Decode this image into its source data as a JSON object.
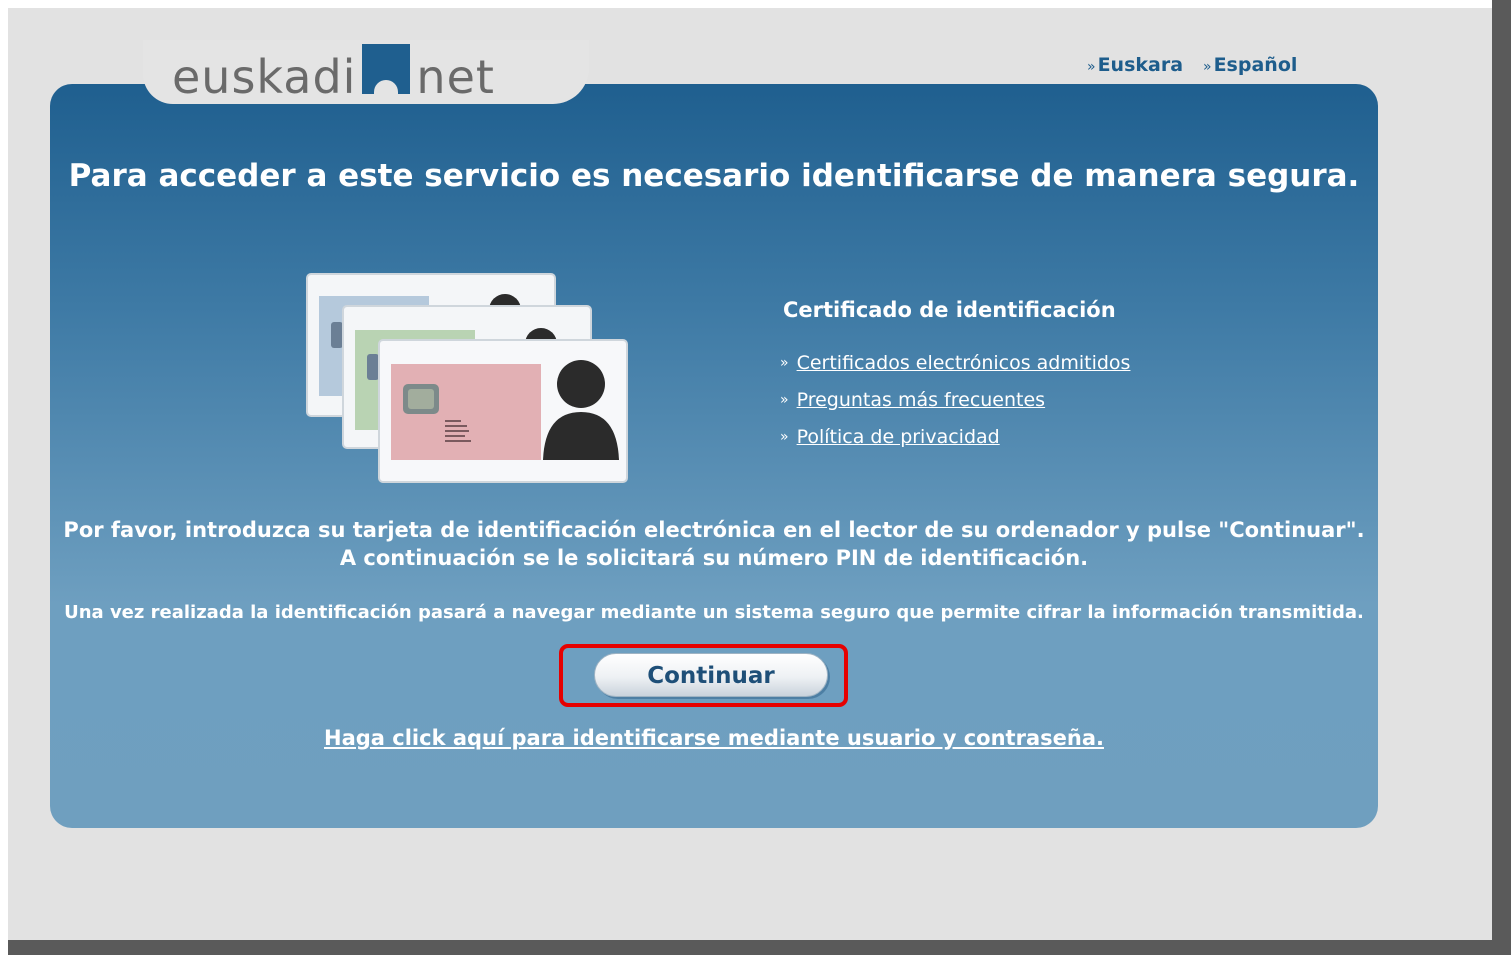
{
  "header": {
    "logo_text_left": "euskadi",
    "logo_text_right": "net",
    "languages": [
      {
        "label": "Euskara"
      },
      {
        "label": "Español"
      }
    ],
    "chevron": "»"
  },
  "main": {
    "headline": "Para acceder a este servicio es necesario identificarse de manera segura.",
    "certificate": {
      "title": "Certificado de identificación",
      "links": [
        {
          "label": "Certificados electrónicos admitidos"
        },
        {
          "label": "Preguntas más frecuentes"
        },
        {
          "label": "Política de privacidad"
        }
      ]
    },
    "instructions_line1": "Por favor, introduzca su tarjeta de identificación electrónica en el lector de su ordenador y pulse \"Continuar\".",
    "instructions_line2": "A continuación se le solicitará su número PIN de identificación.",
    "secure_note": "Una vez realizada la identificación pasará a navegar mediante un sistema seguro que permite cifrar la información transmitida.",
    "continue_label": "Continuar",
    "user_password_link": "Haga click aquí para identificarse mediante usuario y contraseña."
  },
  "colors": {
    "panel_top": "#1f5f8f",
    "panel_bottom": "#6f9fbf",
    "link_blue": "#1e5d8c",
    "highlight_red": "#e60000"
  }
}
